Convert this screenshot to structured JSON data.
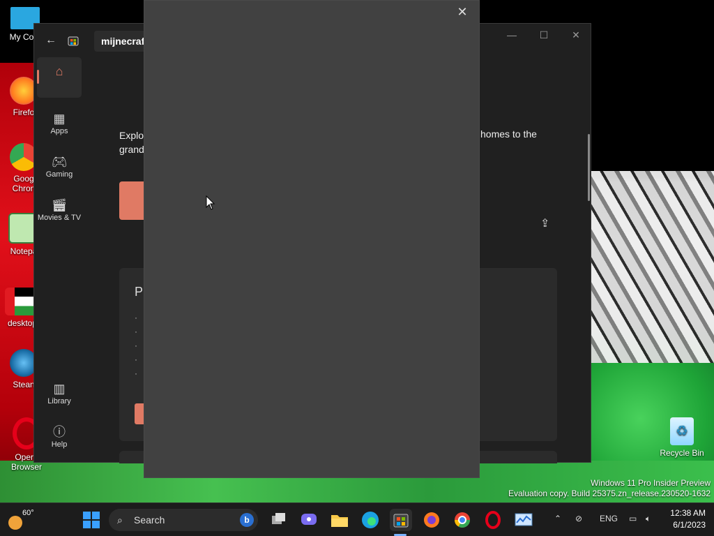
{
  "desktop": {
    "icons": [
      {
        "label": "My Com",
        "color": "#2aa7e0"
      },
      {
        "label": "Firefo",
        "color": "#ff7a1f"
      },
      {
        "label": "Goog Chron",
        "color": "#34a853"
      },
      {
        "label": "Notepa",
        "color": "#7ec97e"
      },
      {
        "label": "desktop-",
        "color": "#e11b22"
      },
      {
        "label": "Stean",
        "color": "#1b6fa8"
      },
      {
        "label": "Opera Browser",
        "color": "#e6001a"
      },
      {
        "label": "Recycle Bin",
        "color": "#8fd7ff"
      }
    ]
  },
  "store": {
    "search_value": "mijnecraft",
    "nav": [
      {
        "label": ""
      },
      {
        "label": "Apps"
      },
      {
        "label": "Gaming"
      },
      {
        "label": "Movies & TV"
      },
      {
        "label": "Library"
      },
      {
        "label": "Help"
      }
    ],
    "content_left": "Explor",
    "content_left2": "grand",
    "content_right": "homes to the",
    "card_title": "Pl"
  },
  "watermark": {
    "line1": "Windows 11 Pro Insider Preview",
    "line2": "Evaluation copy. Build 25375.zn_release.230520-1632"
  },
  "taskbar": {
    "weather_temp": "60°",
    "search_label": "Search",
    "bing_label": "b",
    "language": "ENG",
    "time": "12:38 AM",
    "date": "6/1/2023"
  },
  "colors": {
    "accent": "#e07a64",
    "store_bg": "#202020",
    "dialog_bg": "#414141"
  }
}
